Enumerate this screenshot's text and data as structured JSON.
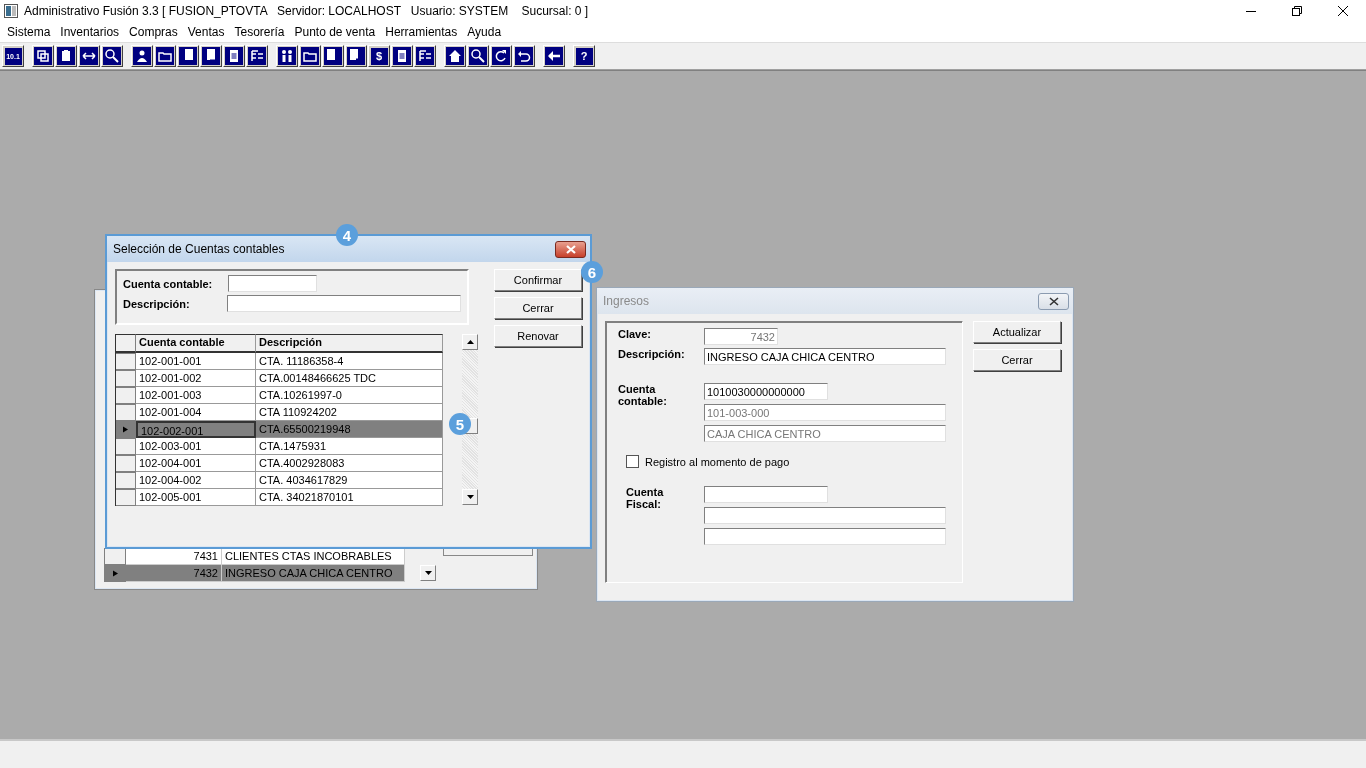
{
  "app_window": {
    "title": "Administrativo Fusión 3.3 [ FUSION_PTOVTA   Servidor: LOCALHOST   Usuario: SYSTEM    Sucursal: 0 ]",
    "menu": [
      "Sistema",
      "Inventarios",
      "Compras",
      "Ventas",
      "Tesorería",
      "Punto de venta",
      "Herramientas",
      "Ayuda"
    ],
    "toolbar": [
      [
        {
          "kind": "glyph",
          "glyph": "10.1"
        }
      ],
      [
        {
          "kind": "copy"
        },
        {
          "kind": "clipboard"
        },
        {
          "kind": "swap"
        },
        {
          "kind": "magnifier"
        }
      ],
      [
        {
          "kind": "person"
        },
        {
          "kind": "folder"
        },
        {
          "kind": "doc-left"
        },
        {
          "kind": "doc-minus"
        },
        {
          "kind": "doc"
        },
        {
          "kind": "list"
        }
      ],
      [
        {
          "kind": "people"
        },
        {
          "kind": "folder"
        },
        {
          "kind": "doc-right"
        },
        {
          "kind": "doc-plus"
        },
        {
          "kind": "glyph",
          "glyph": "$"
        },
        {
          "kind": "doc"
        },
        {
          "kind": "list"
        }
      ],
      [
        {
          "kind": "home"
        },
        {
          "kind": "magnifier"
        },
        {
          "kind": "redo"
        },
        {
          "kind": "undo"
        }
      ],
      [
        {
          "kind": "back"
        }
      ],
      [
        {
          "kind": "glyph",
          "glyph": "?"
        }
      ]
    ]
  },
  "back_window": {
    "rows": [
      {
        "clave": "7431",
        "descripcion": "CLIENTES CTAS INCOBRABLES",
        "selected": false
      },
      {
        "clave": "7432",
        "descripcion": "INGRESO CAJA CHICA CENTRO",
        "selected": true
      }
    ]
  },
  "seleccion_dialog": {
    "title": "Selección de Cuentas contables",
    "filters": [
      {
        "label": "Cuenta contable:"
      },
      {
        "label": "Descripción:"
      }
    ],
    "columns": [
      "Cuenta contable",
      "Descripción"
    ],
    "rows": [
      {
        "cuenta": "102-001-001",
        "descripcion": "CTA.  11186358-4",
        "selected": false
      },
      {
        "cuenta": "102-001-002",
        "descripcion": "CTA.00148466625 TDC",
        "selected": false
      },
      {
        "cuenta": "102-001-003",
        "descripcion": "CTA.10261997-0",
        "selected": false
      },
      {
        "cuenta": "102-001-004",
        "descripcion": "CTA 110924202",
        "selected": false
      },
      {
        "cuenta": "102-002-001",
        "descripcion": "CTA.65500219948",
        "selected": true
      },
      {
        "cuenta": "102-003-001",
        "descripcion": "CTA.1475931",
        "selected": false
      },
      {
        "cuenta": "102-004-001",
        "descripcion": "CTA.4002928083",
        "selected": false
      },
      {
        "cuenta": "102-004-002",
        "descripcion": "CTA.  4034617829",
        "selected": false
      },
      {
        "cuenta": "102-005-001",
        "descripcion": "CTA.  34021870101",
        "selected": false
      }
    ],
    "buttons": [
      "Confirmar",
      "Cerrar",
      "Renovar"
    ]
  },
  "ingresos_window": {
    "title": "Ingresos",
    "clave": {
      "label": "Clave:",
      "value": "7432",
      "disabled": true
    },
    "descripcion": {
      "label": "Descripción:",
      "value": "INGRESO CAJA CHICA CENTRO",
      "disabled": false
    },
    "cuenta_contable": {
      "label": "Cuenta contable:",
      "fields": [
        {
          "value": "1010030000000000",
          "disabled": false
        },
        {
          "value": "101-003-000",
          "disabled": true
        },
        {
          "value": "CAJA CHICA CENTRO",
          "disabled": true
        }
      ]
    },
    "registro_checkbox": {
      "label": "Registro al momento de pago",
      "checked": false
    },
    "cuenta_fiscal": {
      "label": "Cuenta Fiscal:"
    },
    "buttons": [
      "Actualizar",
      "Cerrar"
    ]
  },
  "callouts": [
    {
      "label": "4"
    },
    {
      "label": "5"
    },
    {
      "label": "6"
    }
  ]
}
